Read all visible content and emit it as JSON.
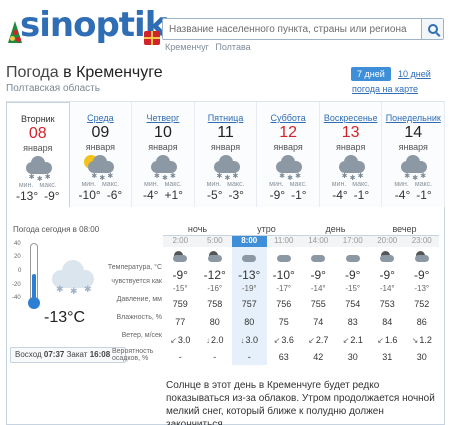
{
  "logo": {
    "text": "sinoptik"
  },
  "search": {
    "placeholder": "Название населенного пункта, страны или региона"
  },
  "recent": [
    "Кременчуг",
    "Полтава"
  ],
  "title": {
    "prefix": "Погода",
    "city": "в Кременчуге"
  },
  "region": "Полтавская область",
  "tabs": {
    "seven": "7 дней",
    "ten": "10 дней",
    "map": "погода на карте"
  },
  "days": [
    {
      "name": "Вторник",
      "num": "08",
      "month": "января",
      "red": true,
      "min_label": "мин.",
      "max_label": "макс.",
      "min": "-13°",
      "max": "-9°",
      "icon": "cloud-snow-icon"
    },
    {
      "name": "Среда",
      "num": "09",
      "month": "января",
      "red": false,
      "min_label": "мин.",
      "max_label": "макс.",
      "min": "-10°",
      "max": "-6°",
      "icon": "sun-cloud-snow-icon"
    },
    {
      "name": "Четверг",
      "num": "10",
      "month": "января",
      "red": false,
      "min_label": "мин.",
      "max_label": "макс.",
      "min": "-4°",
      "max": "+1°",
      "icon": "cloud-snow-icon"
    },
    {
      "name": "Пятница",
      "num": "11",
      "month": "января",
      "red": false,
      "min_label": "мин.",
      "max_label": "макс.",
      "min": "-5°",
      "max": "-3°",
      "icon": "cloud-snow-icon"
    },
    {
      "name": "Суббота",
      "num": "12",
      "month": "января",
      "red": true,
      "min_label": "мин.",
      "max_label": "макс.",
      "min": "-9°",
      "max": "-1°",
      "icon": "cloud-snow-icon"
    },
    {
      "name": "Воскресенье",
      "num": "13",
      "month": "января",
      "red": true,
      "min_label": "мин.",
      "max_label": "макс.",
      "min": "-4°",
      "max": "-1°",
      "icon": "cloud-snow-icon"
    },
    {
      "name": "Понедельник",
      "num": "14",
      "month": "января",
      "red": false,
      "min_label": "мин.",
      "max_label": "макс.",
      "min": "-4°",
      "max": "-1°",
      "icon": "cloud-snow-icon"
    }
  ],
  "today": {
    "label": "Погода сегодня в 08:00",
    "temp": "-13°C",
    "scale": [
      "40",
      "20",
      "0",
      "-20",
      "-40"
    ],
    "sunrise_label": "Восход",
    "sunrise": "07:37",
    "sunset_label": "Закат",
    "sunset": "16:08"
  },
  "hourly": {
    "periods": [
      "ночь",
      "утро",
      "день",
      "вечер"
    ],
    "times": [
      "2:00",
      "5:00",
      "8:00",
      "11:00",
      "14:00",
      "17:00",
      "20:00",
      "23:00"
    ],
    "now_index": 2,
    "labels": {
      "temp": "Температура, °C",
      "feels": "чувствуется как",
      "pressure": "Давление, мм",
      "humidity": "Влажность, %",
      "wind": "Ветер, м/сек",
      "precip": "Вероятность осадков, %"
    },
    "temp": [
      "-9°",
      "-12°",
      "-13°",
      "-10°",
      "-9°",
      "-9°",
      "-9°",
      "-9°"
    ],
    "feels": [
      "-15°",
      "-16°",
      "-19°",
      "-17°",
      "-14°",
      "-15°",
      "-14°",
      "-13°"
    ],
    "pressure": [
      "759",
      "758",
      "757",
      "756",
      "755",
      "754",
      "753",
      "752"
    ],
    "humidity": [
      "77",
      "80",
      "80",
      "75",
      "74",
      "83",
      "84",
      "86"
    ],
    "wind": [
      "3.0",
      "2.0",
      "3.0",
      "3.6",
      "2.7",
      "2.1",
      "1.6",
      "1.2"
    ],
    "wind_arrows": [
      "↙",
      "↓",
      "↓",
      "↙",
      "↙",
      "↙",
      "↙",
      "↘"
    ],
    "precip": [
      "-",
      "-",
      "-",
      "63",
      "42",
      "30",
      "31",
      "30"
    ]
  },
  "description": "Солнце в этот день в Кременчуге будет редко показываться из-за облаков. Утром продолжается ночной мелкий снег, который ближе к полудню должен закончиться."
}
